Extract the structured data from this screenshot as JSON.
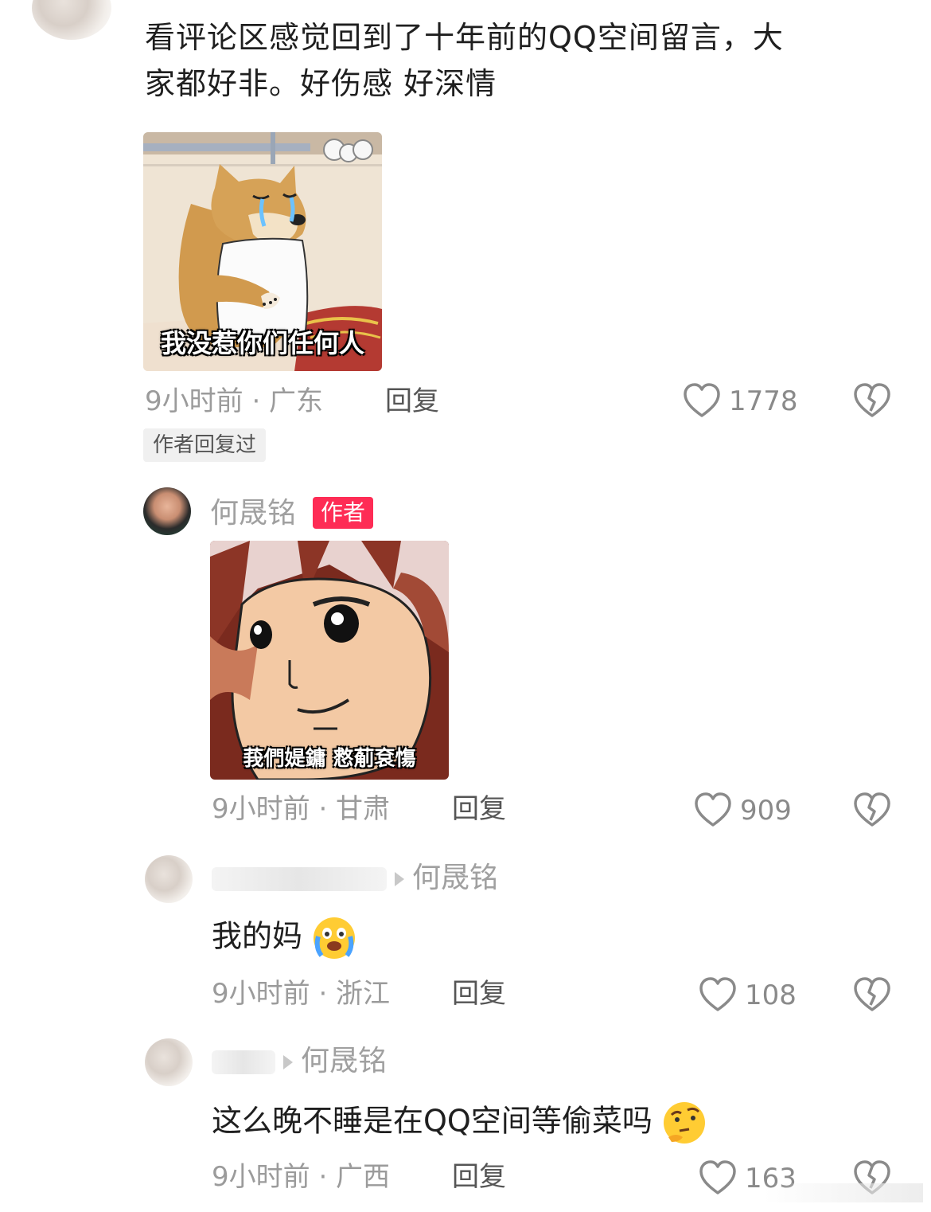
{
  "comment": {
    "text_line1": "看评论区感觉回到了十年前的QQ空间留言，大",
    "text_line2": "家都好非。好伤感 好深情",
    "meme_caption": "我没惹你们任何人",
    "meta": "9小时前 · 广东",
    "reply_label": "回复",
    "likes": "1778",
    "author_replied_tag": "作者回复过"
  },
  "replies": [
    {
      "username": "何晟铭",
      "author_tag": "作者",
      "meme_caption": "莪們媞鏞 慦葪袞慯",
      "meta": "9小时前 · 甘肃",
      "reply_label": "回复",
      "likes": "909"
    },
    {
      "reply_to": "何晟铭",
      "text": "我的妈",
      "meta": "9小时前 · 浙江",
      "reply_label": "回复",
      "likes": "108"
    },
    {
      "reply_to": "何晟铭",
      "text": "这么晚不睡是在QQ空间等偷菜吗",
      "meta": "9小时前 · 广西",
      "reply_label": "回复",
      "likes": "163"
    }
  ],
  "colors": {
    "author_tag_bg": "#fe2c55",
    "meta_gray": "#9b9b9b"
  },
  "icons": {
    "like": "heart-outline-icon",
    "dislike": "broken-heart-icon"
  }
}
